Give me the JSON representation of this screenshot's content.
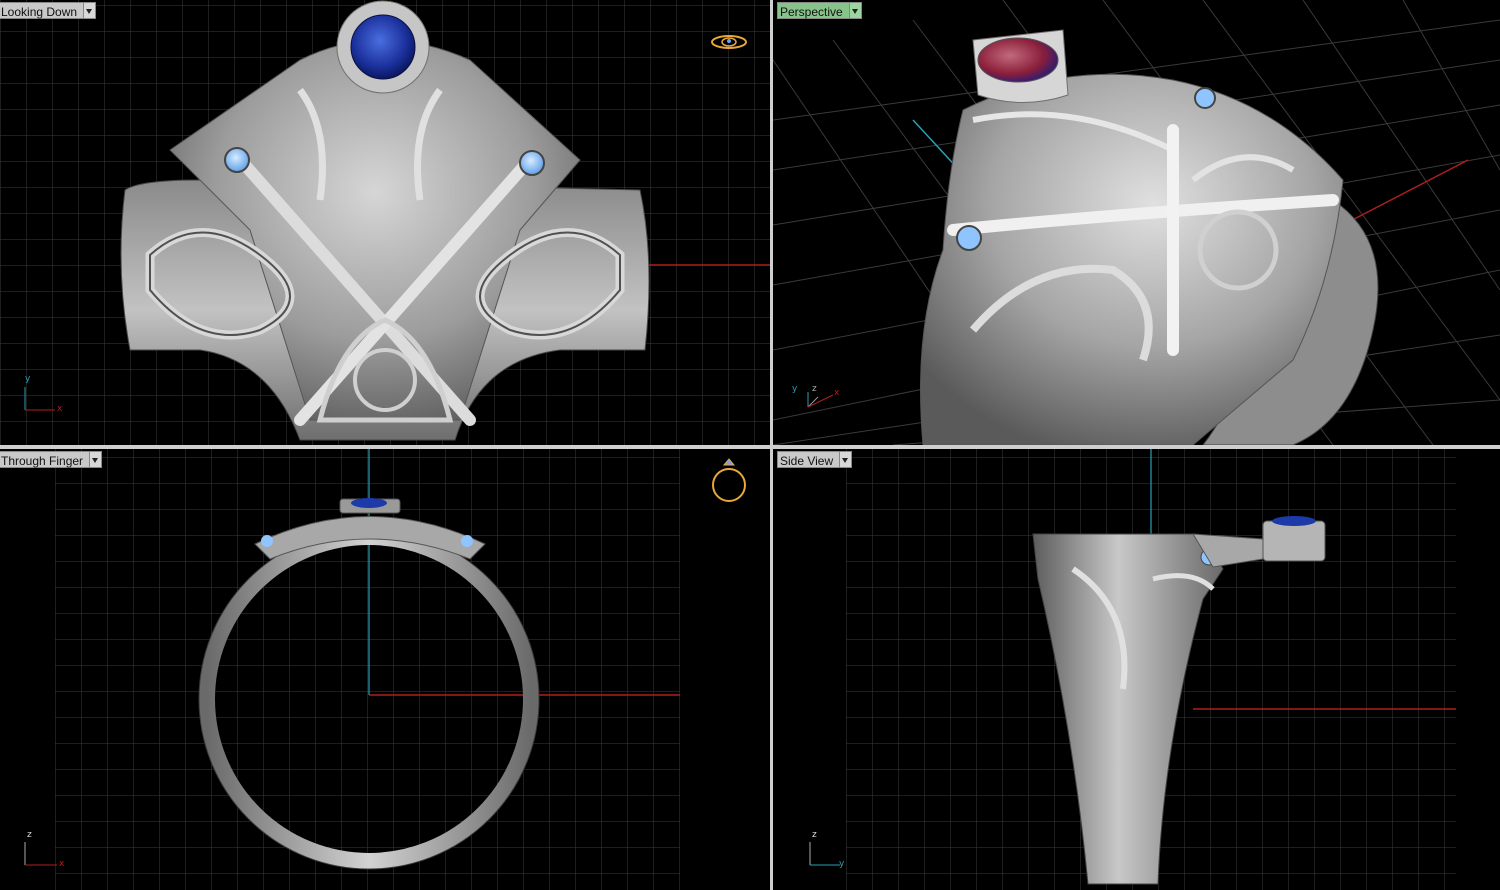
{
  "viewports": {
    "top_left": {
      "label": "Looking Down",
      "axes": {
        "vertical": "y",
        "horizontal": "x"
      },
      "active": false
    },
    "top_right": {
      "label": "Perspective",
      "axes": {
        "vertical": "y",
        "depth": "z",
        "horizontal": "x"
      },
      "active": true
    },
    "bottom_left": {
      "label": "Through Finger",
      "axes": {
        "vertical": "z",
        "horizontal": "x"
      },
      "active": false
    },
    "bottom_right": {
      "label": "Side View",
      "axes": {
        "vertical": "z",
        "horizontal": "y"
      },
      "active": false
    }
  },
  "colors": {
    "grid": "#3a3a3a",
    "axis_x": "#b01e1e",
    "axis_y": "#2a9fb5",
    "metal": "#a9a9a9",
    "sapphire": "#1c3aa8",
    "side_stone": "#7fb6f0",
    "ruby_reflection": "#b2344a",
    "active_label": "#86c48a"
  },
  "icons": {
    "nav_top_left": "ring-top-view-icon",
    "nav_bottom_left": "ring-front-view-icon"
  }
}
